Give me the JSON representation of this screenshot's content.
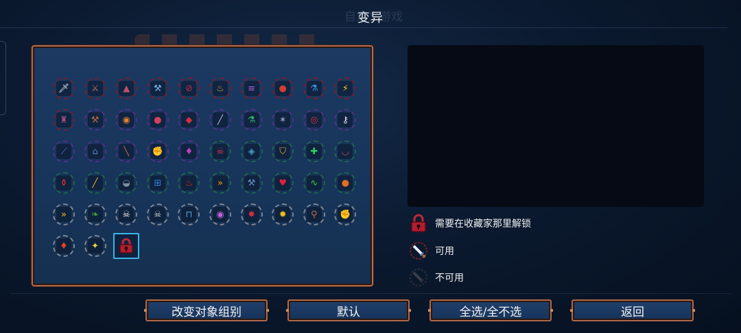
{
  "title": "变异",
  "ghost_title": "自定义游戏",
  "colors": {
    "ring_red": "#7a1e2a",
    "ring_purple": "#5a2f8a",
    "ring_green": "#1f6a4a",
    "ring_gray": "#8a8f99",
    "panel_border": "#b86a4a",
    "selected_border": "#3ab6e6"
  },
  "grid": {
    "rows": [
      [
        {
          "icon": "sword-blade-icon",
          "ring": "red",
          "glyph": "🗡",
          "color": "#dfe6f0"
        },
        {
          "icon": "crossbow-icon",
          "ring": "red",
          "glyph": "⚔",
          "color": "#b07a5a"
        },
        {
          "icon": "tent-fire-icon",
          "ring": "red",
          "glyph": "▲",
          "color": "#c0506a"
        },
        {
          "icon": "scythe-blue-icon",
          "ring": "red",
          "glyph": "⚒",
          "color": "#7ab6f0"
        },
        {
          "icon": "striped-orb-icon",
          "ring": "red",
          "glyph": "⊘",
          "color": "#c0304a"
        },
        {
          "icon": "potion-icon",
          "ring": "red",
          "glyph": "♨",
          "color": "#e0a040"
        },
        {
          "icon": "purple-gun-icon",
          "ring": "red",
          "glyph": "≡",
          "color": "#a060d0"
        },
        {
          "icon": "red-skull-orb-icon",
          "ring": "red",
          "glyph": "●",
          "color": "#d04030"
        },
        {
          "icon": "blue-flask-icon",
          "ring": "red",
          "glyph": "⚗",
          "color": "#3a90e0"
        },
        {
          "icon": "lightning-icon",
          "ring": "red",
          "glyph": "⚡",
          "color": "#f0d020"
        }
      ],
      [
        {
          "icon": "wizard-hat-icon",
          "ring": "red",
          "glyph": "♜",
          "color": "#a05080"
        },
        {
          "icon": "wrench-hammer-icon",
          "ring": "purple",
          "glyph": "⚒",
          "color": "#b07040"
        },
        {
          "icon": "orange-ring-icon",
          "ring": "purple",
          "glyph": "◉",
          "color": "#e08030"
        },
        {
          "icon": "bomb-icon",
          "ring": "purple",
          "glyph": "●",
          "color": "#d04060"
        },
        {
          "icon": "red-diamond-icon",
          "ring": "purple",
          "glyph": "◆",
          "color": "#d03040"
        },
        {
          "icon": "dagger-icon",
          "ring": "purple",
          "glyph": "╱",
          "color": "#b0c0e0"
        },
        {
          "icon": "green-flask-icon",
          "ring": "purple",
          "glyph": "⚗",
          "color": "#30b070"
        },
        {
          "icon": "star-blade-icon",
          "ring": "purple",
          "glyph": "✶",
          "color": "#90a0c0"
        },
        {
          "icon": "red-target-icon",
          "ring": "purple",
          "glyph": "◎",
          "color": "#e03030"
        },
        {
          "icon": "key-icon",
          "ring": "purple",
          "glyph": "⚷",
          "color": "#e0e0f0"
        }
      ],
      [
        {
          "icon": "blue-scythe-icon",
          "ring": "purple",
          "glyph": "⟋",
          "color": "#6070d0"
        },
        {
          "icon": "turret-icon",
          "ring": "purple",
          "glyph": "⌂",
          "color": "#6080c0"
        },
        {
          "icon": "spear-icon",
          "ring": "purple",
          "glyph": "╲",
          "color": "#c07050"
        },
        {
          "icon": "brown-gauntlet-icon",
          "ring": "purple",
          "glyph": "✊",
          "color": "#b06030"
        },
        {
          "icon": "purple-drop-icon",
          "ring": "purple",
          "glyph": "♦",
          "color": "#c040c0"
        },
        {
          "icon": "skull-crossbones-icon",
          "ring": "green",
          "glyph": "☠",
          "color": "#d03050"
        },
        {
          "icon": "blue-shield-icon",
          "ring": "green",
          "glyph": "◈",
          "color": "#40a0c0"
        },
        {
          "icon": "gold-shield-icon",
          "ring": "green",
          "glyph": "⛉",
          "color": "#e0b030"
        },
        {
          "icon": "green-cross-icon",
          "ring": "green",
          "glyph": "✚",
          "color": "#30d060"
        },
        {
          "icon": "fang-icon",
          "ring": "green",
          "glyph": "◡",
          "color": "#e04050"
        }
      ],
      [
        {
          "icon": "red-potion-icon",
          "ring": "green",
          "glyph": "⚱",
          "color": "#e03040"
        },
        {
          "icon": "gold-staff-icon",
          "ring": "green",
          "glyph": "╱",
          "color": "#e0b030"
        },
        {
          "icon": "dark-helmet-icon",
          "ring": "green",
          "glyph": "◒",
          "color": "#8090a0"
        },
        {
          "icon": "blue-gate-icon",
          "ring": "green",
          "glyph": "⊞",
          "color": "#3080e0"
        },
        {
          "icon": "red-flame-icon",
          "ring": "green",
          "glyph": "♨",
          "color": "#e03020"
        },
        {
          "icon": "double-arrow-icon",
          "ring": "green",
          "glyph": "»",
          "color": "#f0a010"
        },
        {
          "icon": "shield-hammer-icon",
          "ring": "green",
          "glyph": "⚒",
          "color": "#6090c0"
        },
        {
          "icon": "red-heart-icon",
          "ring": "green",
          "glyph": "♥",
          "color": "#e02040"
        },
        {
          "icon": "green-snake-icon",
          "ring": "green",
          "glyph": "∿",
          "color": "#40d040"
        },
        {
          "icon": "orange-apple-icon",
          "ring": "green",
          "glyph": "●",
          "color": "#e07020"
        }
      ],
      [
        {
          "icon": "yellow-chevrons-icon",
          "ring": "gray",
          "glyph": "»",
          "color": "#f0c020"
        },
        {
          "icon": "green-leaf-icon",
          "ring": "gray",
          "glyph": "❧",
          "color": "#40a040"
        },
        {
          "icon": "skull-green-eyes-icon",
          "ring": "gray",
          "glyph": "☠",
          "color": "#e0e0e0"
        },
        {
          "icon": "gray-skull-icon",
          "ring": "gray",
          "glyph": "☠",
          "color": "#c0c8d0"
        },
        {
          "icon": "blue-chest-icon",
          "ring": "gray",
          "glyph": "⊓",
          "color": "#50a0e0"
        },
        {
          "icon": "purple-orb-icon",
          "ring": "gray",
          "glyph": "◉",
          "color": "#c060e0"
        },
        {
          "icon": "red-shuriken-icon",
          "ring": "gray",
          "glyph": "✸",
          "color": "#d03040"
        },
        {
          "icon": "gold-burst-icon",
          "ring": "gray",
          "glyph": "✹",
          "color": "#f0c020"
        },
        {
          "icon": "bone-club-icon",
          "ring": "gray",
          "glyph": "⚲",
          "color": "#c07050"
        },
        {
          "icon": "gold-fist-icon",
          "ring": "gray",
          "glyph": "✊",
          "color": "#f0b020"
        }
      ],
      [
        {
          "icon": "flame-drop-icon",
          "ring": "gray",
          "glyph": "♦",
          "color": "#e04020"
        },
        {
          "icon": "sparkle-icon",
          "ring": "gray",
          "glyph": "✦",
          "color": "#f0d040"
        },
        {
          "icon": "lock-icon",
          "ring": "none",
          "glyph": "🔒",
          "color": "#c02030",
          "selected": true
        }
      ]
    ]
  },
  "legend": [
    {
      "name": "locked",
      "text": "需要在收藏家那里解锁"
    },
    {
      "name": "available",
      "text": "可用"
    },
    {
      "name": "unavailable",
      "text": "不可用"
    }
  ],
  "buttons": {
    "change_group": "改变对象组别",
    "default": "默认",
    "select_all": "全选/全不选",
    "back": "返回"
  }
}
